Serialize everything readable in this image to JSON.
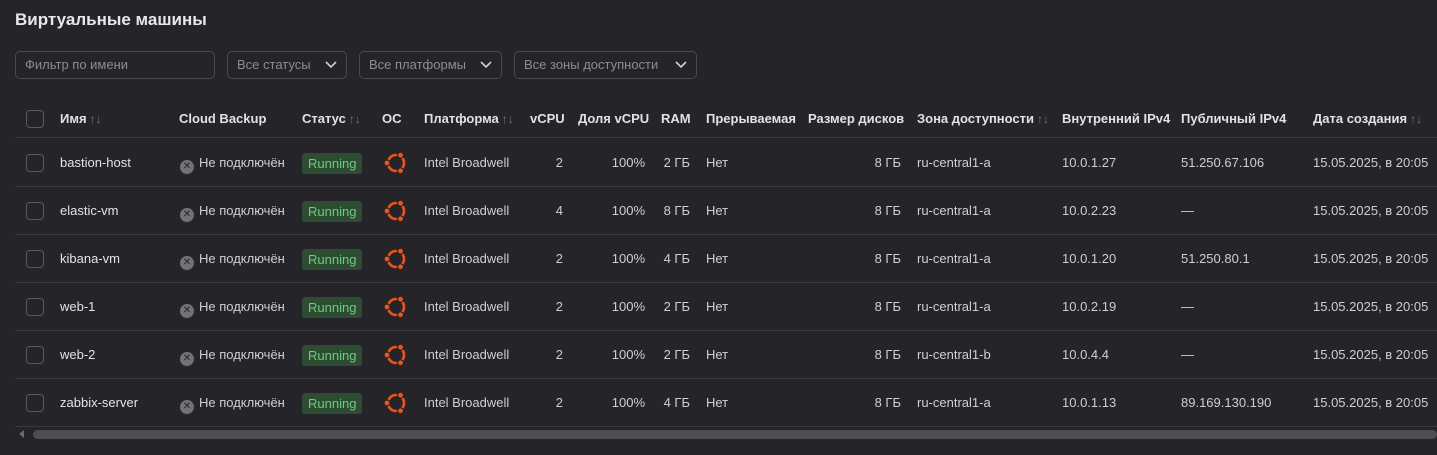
{
  "page": {
    "title": "Виртуальные машины"
  },
  "filters": {
    "name_placeholder": "Фильтр по имени",
    "status": "Все статусы",
    "platform": "Все платформы",
    "zone": "Все зоны доступности"
  },
  "columns": {
    "name": "Имя",
    "backup": "Cloud Backup",
    "status": "Статус",
    "os": "ОС",
    "platform": "Платформа",
    "vcpu": "vCPU",
    "vcpu_share": "Доля vCPU",
    "ram": "RAM",
    "preemptible": "Прерываемая",
    "disk": "Размер дисков",
    "zone": "Зона доступности",
    "ipv4_int": "Внутренний IPv4",
    "ipv4_pub": "Публичный IPv4",
    "created": "Дата создания",
    "sort_glyph": "↑↓"
  },
  "colors": {
    "running_bg": "#2e4b34",
    "running_text": "#6bcf7c",
    "ubuntu": "#e95420"
  },
  "rows": [
    {
      "name": "bastion-host",
      "backup": "Не подключён",
      "status": "Running",
      "os_icon": "ubuntu-icon",
      "platform": "Intel Broadwell",
      "vcpu": "2",
      "share": "100%",
      "ram": "2 ГБ",
      "preemptible": "Нет",
      "disk": "8 ГБ",
      "zone": "ru-central1-a",
      "ip_int": "10.0.1.27",
      "ip_pub": "51.250.67.106",
      "created": "15.05.2025, в 20:05"
    },
    {
      "name": "elastic-vm",
      "backup": "Не подключён",
      "status": "Running",
      "os_icon": "ubuntu-icon",
      "platform": "Intel Broadwell",
      "vcpu": "4",
      "share": "100%",
      "ram": "8 ГБ",
      "preemptible": "Нет",
      "disk": "8 ГБ",
      "zone": "ru-central1-a",
      "ip_int": "10.0.2.23",
      "ip_pub": "—",
      "created": "15.05.2025, в 20:05"
    },
    {
      "name": "kibana-vm",
      "backup": "Не подключён",
      "status": "Running",
      "os_icon": "ubuntu-icon",
      "platform": "Intel Broadwell",
      "vcpu": "2",
      "share": "100%",
      "ram": "4 ГБ",
      "preemptible": "Нет",
      "disk": "8 ГБ",
      "zone": "ru-central1-a",
      "ip_int": "10.0.1.20",
      "ip_pub": "51.250.80.1",
      "created": "15.05.2025, в 20:05"
    },
    {
      "name": "web-1",
      "backup": "Не подключён",
      "status": "Running",
      "os_icon": "ubuntu-icon",
      "platform": "Intel Broadwell",
      "vcpu": "2",
      "share": "100%",
      "ram": "2 ГБ",
      "preemptible": "Нет",
      "disk": "8 ГБ",
      "zone": "ru-central1-a",
      "ip_int": "10.0.2.19",
      "ip_pub": "—",
      "created": "15.05.2025, в 20:05"
    },
    {
      "name": "web-2",
      "backup": "Не подключён",
      "status": "Running",
      "os_icon": "ubuntu-icon",
      "platform": "Intel Broadwell",
      "vcpu": "2",
      "share": "100%",
      "ram": "2 ГБ",
      "preemptible": "Нет",
      "disk": "8 ГБ",
      "zone": "ru-central1-b",
      "ip_int": "10.0.4.4",
      "ip_pub": "—",
      "created": "15.05.2025, в 20:05"
    },
    {
      "name": "zabbix-server",
      "backup": "Не подключён",
      "status": "Running",
      "os_icon": "ubuntu-icon",
      "platform": "Intel Broadwell",
      "vcpu": "2",
      "share": "100%",
      "ram": "4 ГБ",
      "preemptible": "Нет",
      "disk": "8 ГБ",
      "zone": "ru-central1-a",
      "ip_int": "10.0.1.13",
      "ip_pub": "89.169.130.190",
      "created": "15.05.2025, в 20:05"
    }
  ]
}
